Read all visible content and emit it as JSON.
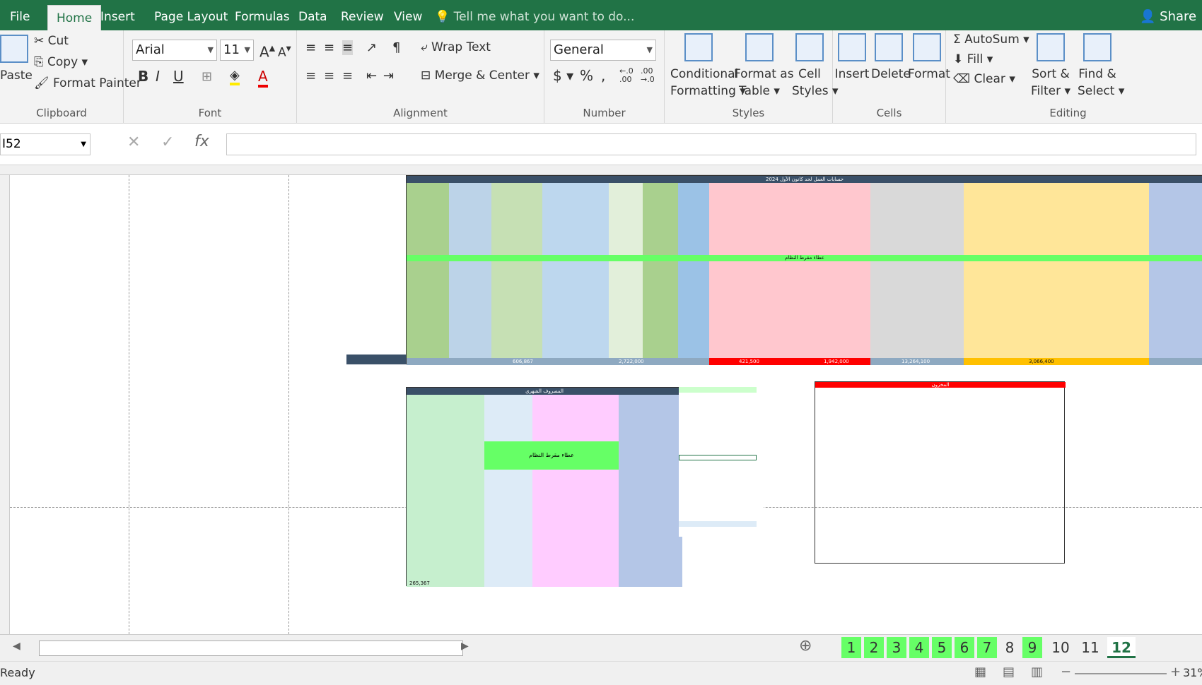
{
  "ribbon_tabs": [
    "File",
    "Home",
    "Insert",
    "Page Layout",
    "Formulas",
    "Data",
    "Review",
    "View"
  ],
  "tell_me": "Tell me what you want to do...",
  "share": "Share",
  "clipboard": {
    "paste": "Paste",
    "cut": "Cut",
    "copy": "Copy",
    "format_painter": "Format Painter",
    "label": "Clipboard"
  },
  "font": {
    "name": "Arial",
    "size": "11",
    "label": "Font"
  },
  "alignment": {
    "wrap": "Wrap Text",
    "merge": "Merge & Center",
    "label": "Alignment"
  },
  "number": {
    "format": "General",
    "label": "Number"
  },
  "styles": {
    "conditional": "Conditional",
    "conditional2": "Formatting",
    "format_as": "Format as",
    "format_as2": "Table",
    "cell": "Cell",
    "cell2": "Styles",
    "label": "Styles"
  },
  "cells": {
    "insert": "Insert",
    "delete": "Delete",
    "format": "Format",
    "label": "Cells"
  },
  "editing": {
    "autosum": "AutoSum",
    "fill": "Fill",
    "clear": "Clear",
    "sort": "Sort &",
    "sort2": "Filter",
    "find": "Find &",
    "find2": "Select",
    "label": "Editing"
  },
  "namebox": "I52",
  "fx": "fx",
  "sheet": {
    "title": "حسابات العمل لحد كانون الأول 2024",
    "total_profit": "606,867",
    "total_sales": "2,722,000",
    "total_expenses": "421,500",
    "total_debts": "1,942,000",
    "total_store": "13,264,100",
    "total_capital": "3,066,400",
    "lower_title": "المصروف الشهري",
    "remaining": "265,367",
    "store_title": "المخزون",
    "stopped": "عطاء مقرط النظام"
  },
  "sheet_tabs": [
    "1",
    "2",
    "3",
    "4",
    "5",
    "6",
    "7",
    "8",
    "9",
    "10",
    "11",
    "12"
  ],
  "status": {
    "ready": "Ready",
    "zoom": "31%"
  }
}
